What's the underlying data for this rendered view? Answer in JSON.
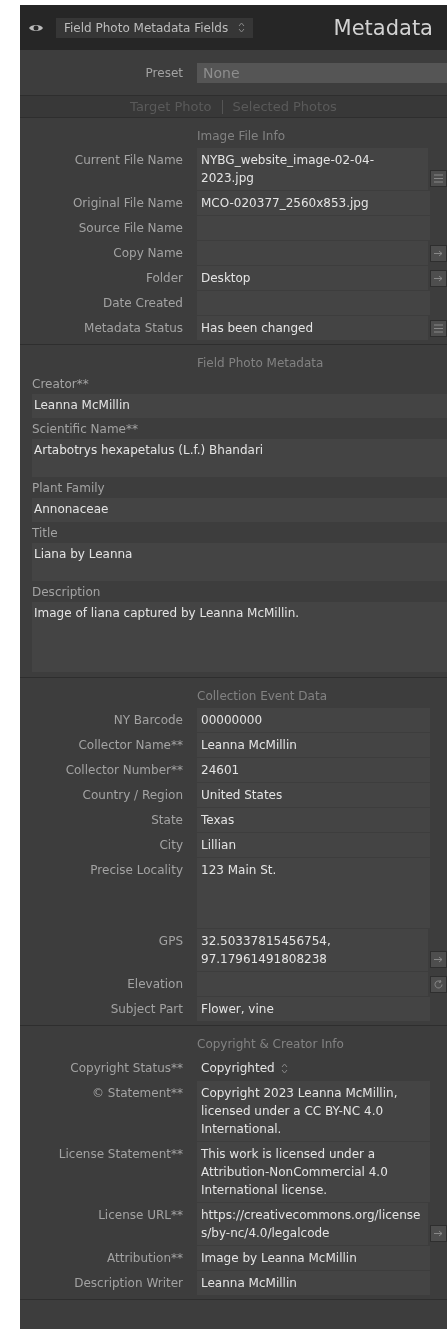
{
  "header": {
    "panel_selector": "Field Photo Metadata Fields",
    "title": "Metadata"
  },
  "preset": {
    "label": "Preset",
    "value": "None"
  },
  "scope_tabs": [
    {
      "label": "Target Photo",
      "disabled": true
    },
    {
      "label": "Selected Photos",
      "disabled": true
    }
  ],
  "sections": [
    {
      "title": "Image File Info",
      "kind": "inline",
      "fields": [
        {
          "label": "Current File Name",
          "value": "NYBG_website_image-02-04-2023.jpg",
          "kind": "text",
          "button": {
            "kind": "list"
          }
        },
        {
          "label": "Original File Name",
          "value": "MCO-020377_2560x853.jpg",
          "kind": "text"
        },
        {
          "label": "Source File Name",
          "kind": "text"
        },
        {
          "label": "Copy Name",
          "kind": "text",
          "button": {
            "kind": "arrow"
          }
        },
        {
          "label": "Folder",
          "value": "Desktop",
          "kind": "text",
          "button": {
            "kind": "arrow"
          }
        },
        {
          "label": "Date Created",
          "kind": "text"
        },
        {
          "label": "Metadata Status",
          "value": "Has been changed",
          "kind": "text",
          "button": {
            "kind": "list"
          }
        }
      ]
    },
    {
      "title": "Field Photo Metadata",
      "kind": "stacked",
      "fields": [
        {
          "label": "Creator**",
          "value": "Leanna McMillin",
          "kind": "text"
        },
        {
          "label": "Scientific Name**",
          "value": "Artabotrys hexapetalus (L.f.) Bhandari",
          "kind": "area"
        },
        {
          "label": "Plant Family",
          "value": "Annonaceae",
          "kind": "text"
        },
        {
          "label": "Title",
          "value": "Liana by Leanna",
          "kind": "area"
        },
        {
          "label": "Description",
          "value": "Image of liana captured by Leanna McMillin.",
          "kind": "large_area"
        }
      ]
    },
    {
      "title": "Collection Event Data",
      "kind": "inline",
      "fields": [
        {
          "label": "NY Barcode",
          "value": "00000000",
          "kind": "text"
        },
        {
          "label": "Collector Name**",
          "value": "Leanna McMillin",
          "kind": "text"
        },
        {
          "label": "Collector Number**",
          "value": "24601",
          "kind": "text"
        },
        {
          "label": "Country / Region",
          "value": "United States",
          "kind": "text"
        },
        {
          "label": "State",
          "value": "Texas",
          "kind": "text"
        },
        {
          "label": "City",
          "value": "Lillian",
          "kind": "text"
        },
        {
          "label": "Precise Locality",
          "value": "123 Main St.",
          "kind": "large_area"
        },
        {
          "label": "GPS",
          "value": "32.50337815456754, 97.17961491808238",
          "kind": "text",
          "button": {
            "kind": "arrow"
          }
        },
        {
          "label": "Elevation",
          "kind": "text",
          "button": {
            "kind": "refresh"
          }
        },
        {
          "label": "Subject Part",
          "value": "Flower, vine",
          "kind": "text"
        }
      ]
    },
    {
      "title": "Copyright & Creator Info",
      "kind": "inline",
      "fields": [
        {
          "label": "Copyright Status**",
          "value": "Copyrighted",
          "kind": "popup"
        },
        {
          "label": "© Statement**",
          "value": "Copyright 2023 Leanna McMillin, licensed under a CC BY-NC 4.0 International.",
          "kind": "text"
        },
        {
          "label": "License Statement**",
          "value": "This work is licensed under a Attribution-NonCommercial 4.0 International license.",
          "kind": "text"
        },
        {
          "label": "License URL**",
          "value": "https://creativecommons.org/licenses/by-nc/4.0/legalcode",
          "kind": "text",
          "button": {
            "kind": "arrow"
          }
        },
        {
          "label": "Attribution**",
          "value": "Image by Leanna McMillin",
          "kind": "text"
        },
        {
          "label": "Description Writer",
          "value": "Leanna McMillin",
          "kind": "text"
        }
      ]
    }
  ]
}
